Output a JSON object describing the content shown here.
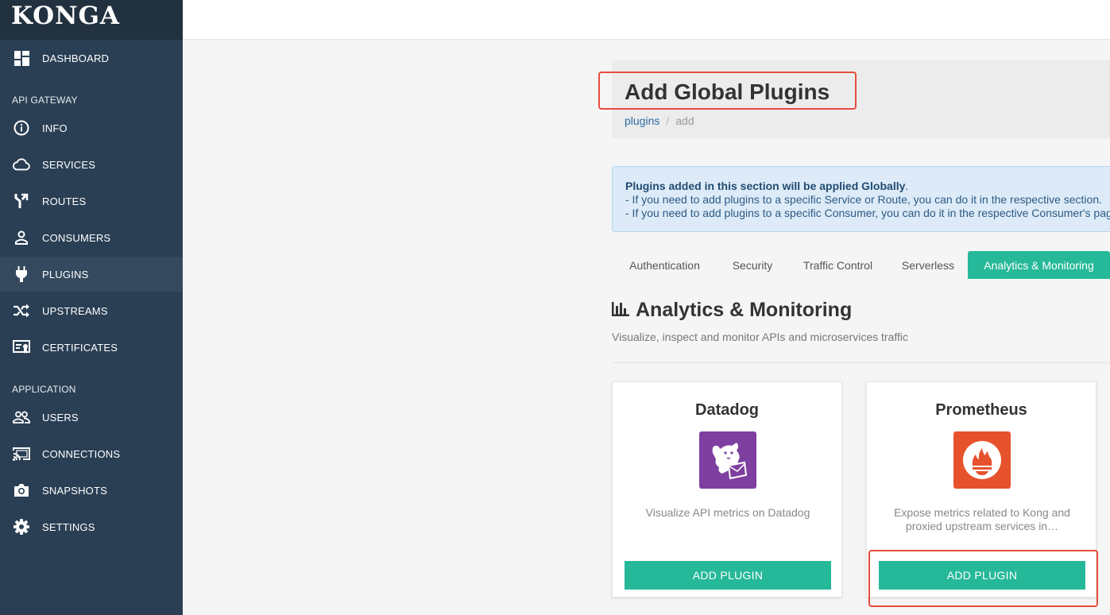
{
  "app": {
    "logo": "KONGA"
  },
  "sidebar": {
    "dashboard": "DASHBOARD",
    "sections": {
      "api_gateway": "API GATEWAY",
      "application": "APPLICATION"
    },
    "items": {
      "info": "INFO",
      "services": "SERVICES",
      "routes": "ROUTES",
      "consumers": "CONSUMERS",
      "plugins": "PLUGINS",
      "upstreams": "UPSTREAMS",
      "certificates": "CERTIFICATES",
      "users": "USERS",
      "connections": "CONNECTIONS",
      "snapshots": "SNAPSHOTS",
      "settings": "SETTINGS"
    },
    "active": "PLUGINS"
  },
  "header": {
    "title": "Add Global Plugins",
    "breadcrumb": {
      "link": "plugins",
      "separator": "/",
      "current": "add"
    }
  },
  "info": {
    "bold": "Plugins added in this section will be applied Globally",
    "bold_suffix": ".",
    "line1": "- If you need to add plugins to a specific Service or Route, you can do it in the respective section.",
    "line2": "- If you need to add plugins to a specific Consumer, you can do it in the respective Consumer's page."
  },
  "tabs": {
    "authentication": "Authentication",
    "security": "Security",
    "traffic_control": "Traffic Control",
    "serverless": "Serverless",
    "analytics": "Analytics & Monitoring"
  },
  "section": {
    "title": "Analytics & Monitoring",
    "subtitle": "Visualize, inspect and monitor APIs and microservices traffic"
  },
  "cards": [
    {
      "title": "Datadog",
      "description": "Visualize API metrics on Datadog",
      "button": "ADD PLUGIN",
      "logo_color": "#7e3fa0",
      "icon": "datadog-icon"
    },
    {
      "title": "Prometheus",
      "description": "Expose metrics related to Kong and proxied upstream services in…",
      "button": "ADD PLUGIN",
      "logo_color": "#e6522c",
      "icon": "prometheus-icon"
    }
  ],
  "colors": {
    "sidebar": "#2a3f54",
    "accent": "#26b999",
    "highlight": "#e74c3c"
  }
}
